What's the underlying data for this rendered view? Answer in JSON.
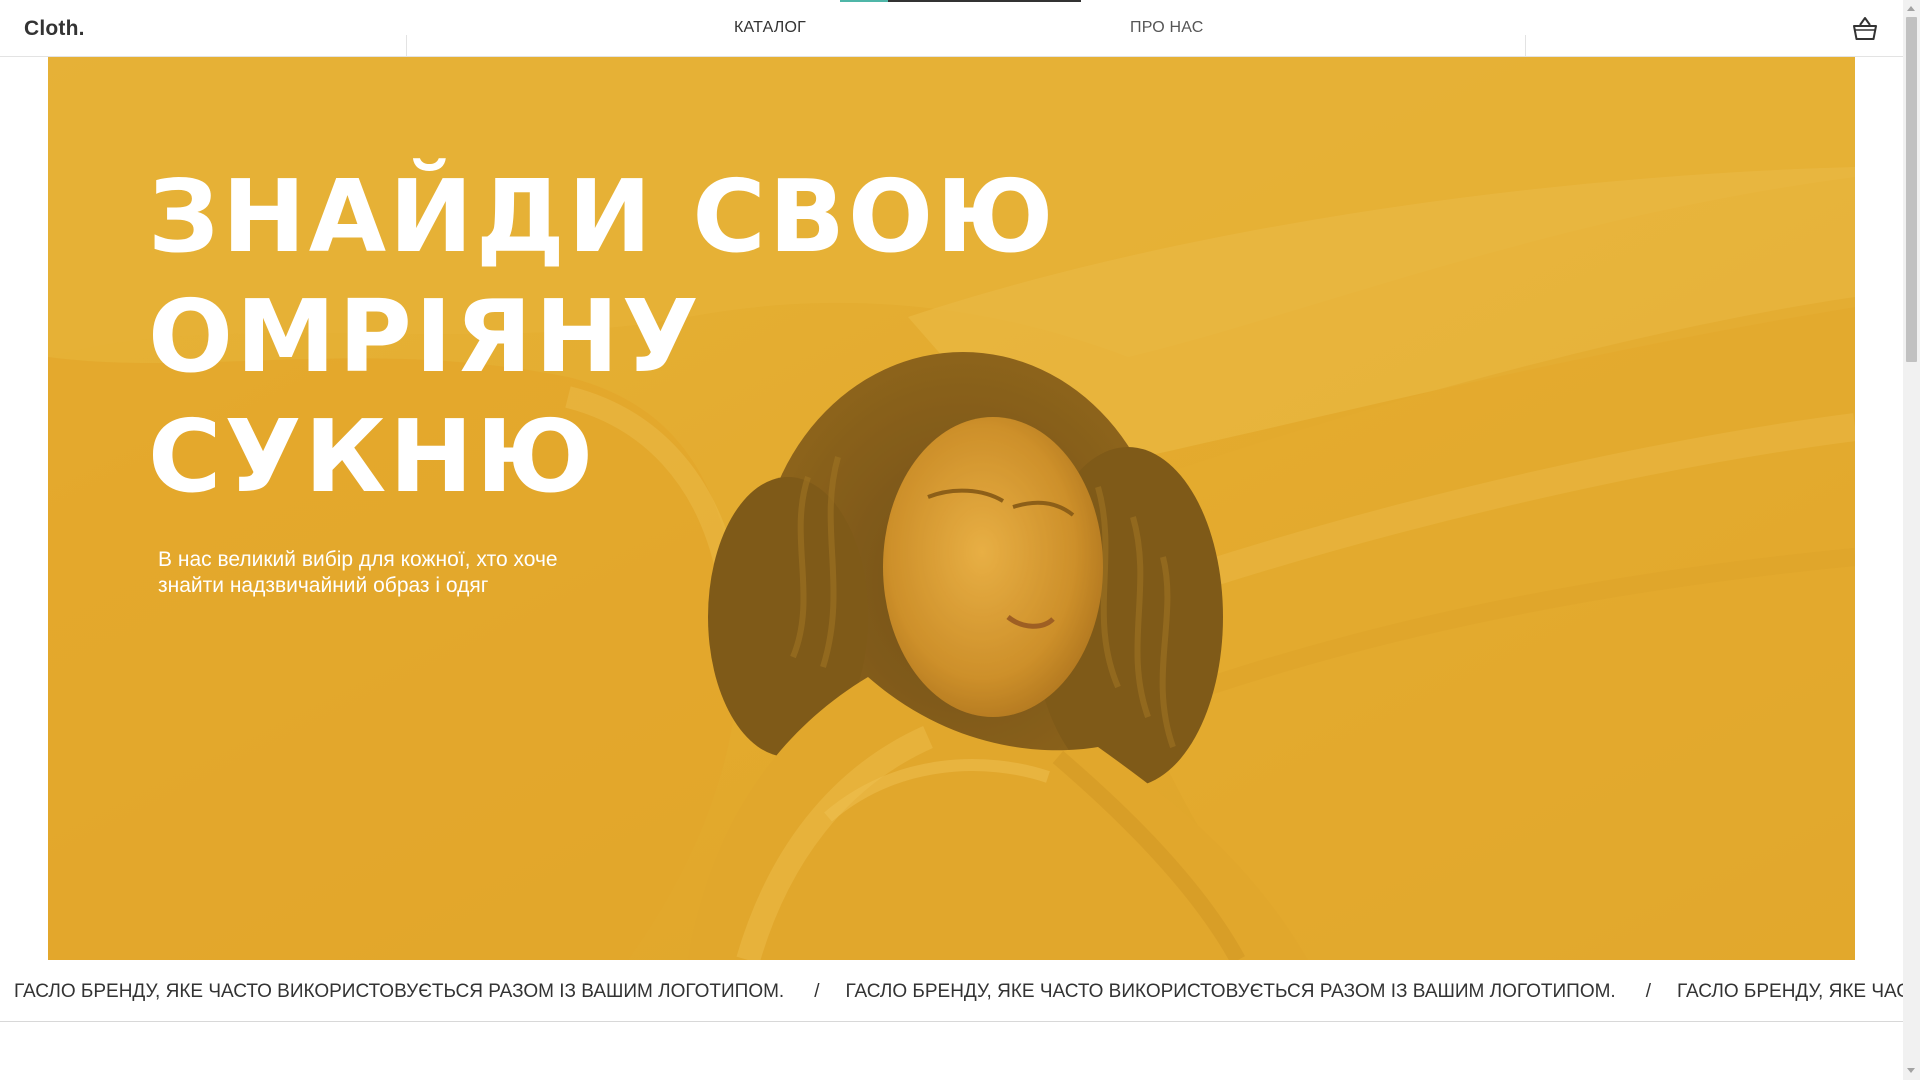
{
  "header": {
    "logo": "Cloth.",
    "nav": {
      "catalog": "КАТАЛОГ",
      "about": "ПРО НАС"
    },
    "cart_icon": "basket-icon"
  },
  "hero": {
    "title": "ЗНАЙДИ СВОЮ ОМРІЯНУ СУКНЮ",
    "subtitle": "В нас великий вибір для кожної, хто хоче знайти надзвичайний образ і одяг",
    "accent_color": "#e5ac2e"
  },
  "ticker": {
    "items": [
      "ГАСЛО БРЕНДУ, ЯКЕ ЧАСТО ВИКОРИСТОВУЄТЬСЯ РАЗОМ ІЗ ВАШИМ ЛОГОТИПОМ.",
      "ГАСЛО БРЕНДУ, ЯКЕ ЧАСТО ВИКОРИСТОВУЄТЬСЯ РАЗОМ ІЗ ВАШИМ ЛОГОТИПОМ.",
      "ГАСЛО БРЕНДУ, ЯКЕ ЧАСТО ВИКОРИСТОВУЄТЬСЯ РАЗОМ ІЗ ВАШИМ ЛОГОТИПОМ."
    ],
    "separator": "/"
  },
  "colors": {
    "nav_indicator": "#333333",
    "nav_indicator_accent": "#4fb6a8",
    "text": "#333333"
  }
}
